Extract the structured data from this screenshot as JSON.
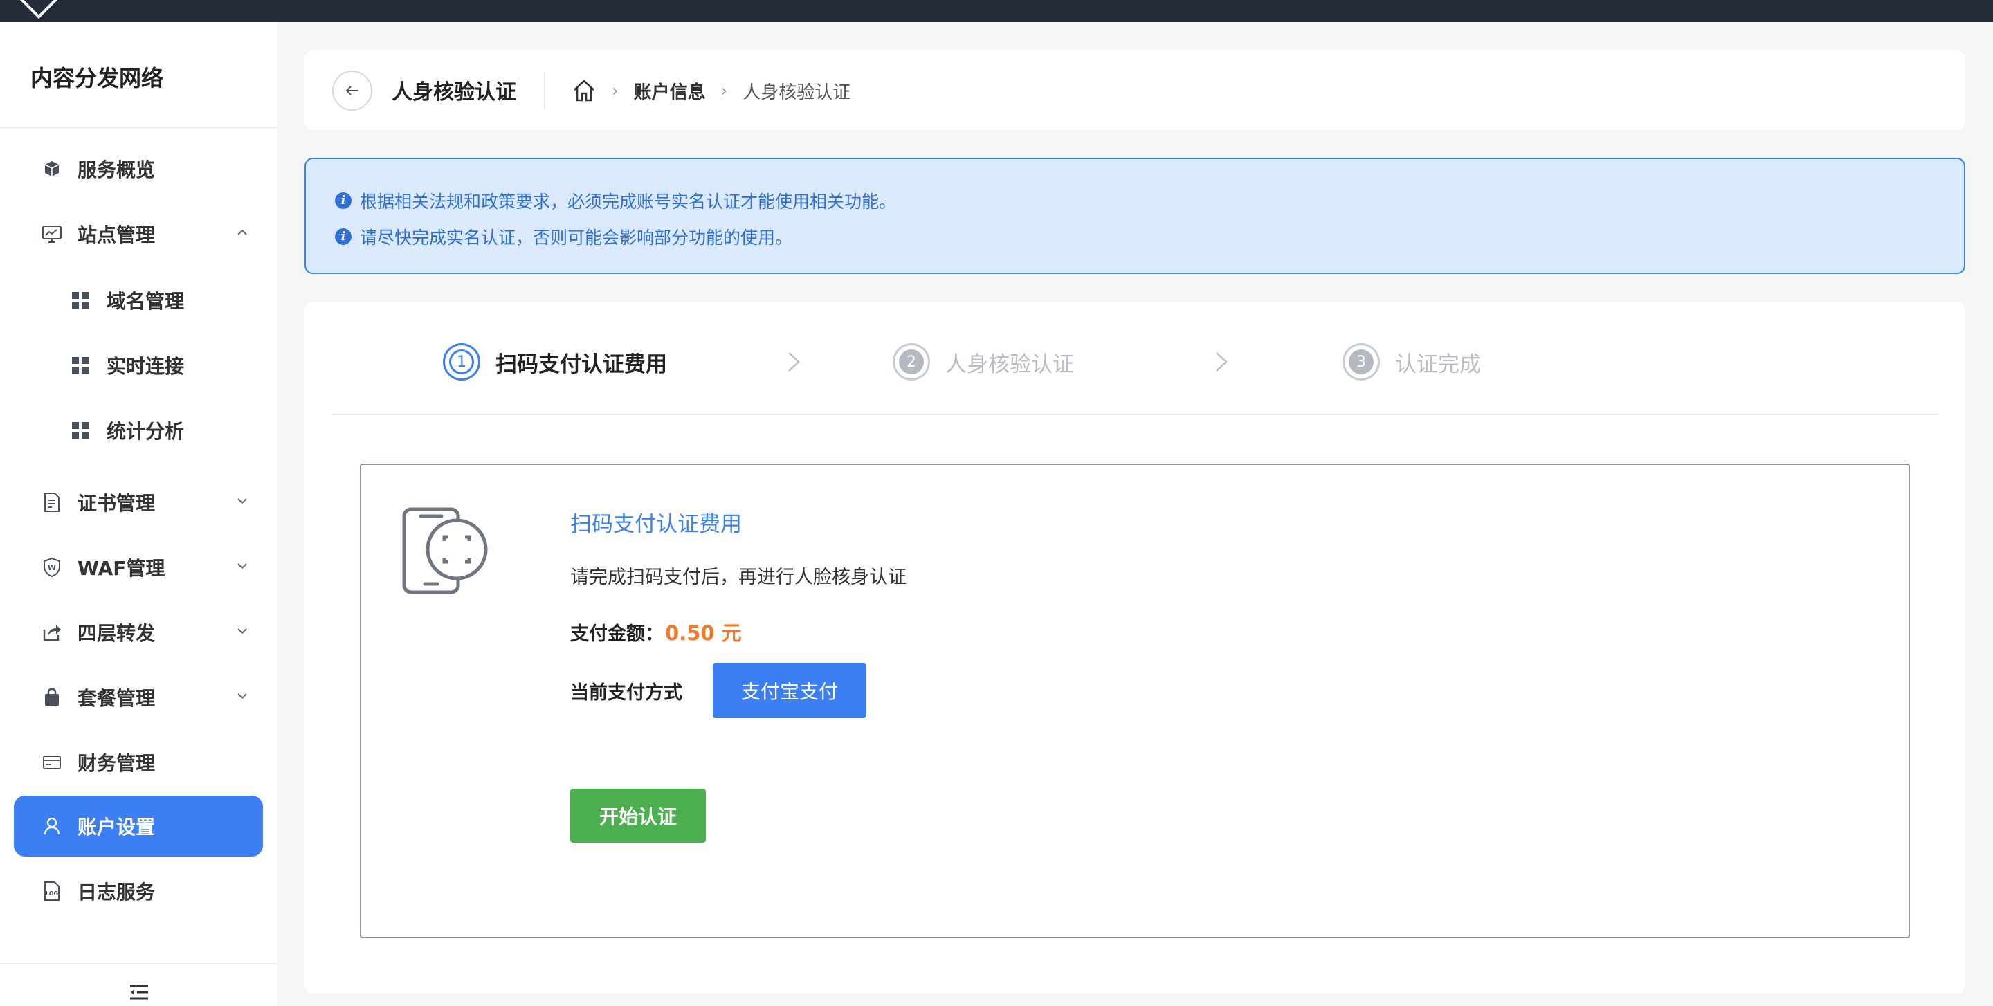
{
  "brand": "内容分发网络",
  "sidebar": {
    "items": [
      {
        "label": "服务概览",
        "icon": "cube-icon"
      },
      {
        "label": "站点管理",
        "icon": "monitor-chart-icon",
        "expanded": true
      },
      {
        "label": "域名管理",
        "icon": "grid-icon"
      },
      {
        "label": "实时连接",
        "icon": "grid-icon"
      },
      {
        "label": "统计分析",
        "icon": "grid-icon"
      },
      {
        "label": "证书管理",
        "icon": "certificate-icon"
      },
      {
        "label": "WAF管理",
        "icon": "shield-icon"
      },
      {
        "label": "四层转发",
        "icon": "share-icon"
      },
      {
        "label": "套餐管理",
        "icon": "bag-icon"
      },
      {
        "label": "财务管理",
        "icon": "card-icon"
      },
      {
        "label": "账户设置",
        "icon": "user-icon",
        "active": true
      },
      {
        "label": "日志服务",
        "icon": "log-icon"
      }
    ]
  },
  "header": {
    "title": "人身核验认证",
    "breadcrumb": [
      "账户信息",
      "人身核验认证"
    ]
  },
  "alert": {
    "lines": [
      "根据相关法规和政策要求，必须完成账号实名认证才能使用相关功能。",
      "请尽快完成实名认证，否则可能会影响部分功能的使用。"
    ]
  },
  "steps": [
    {
      "num": "1",
      "label": "扫码支付认证费用",
      "state": "active"
    },
    {
      "num": "2",
      "label": "人身核验认证",
      "state": "todo"
    },
    {
      "num": "3",
      "label": "认证完成",
      "state": "todo"
    }
  ],
  "payment": {
    "title": "扫码支付认证费用",
    "desc": "请完成扫码支付后，再进行人脸核身认证",
    "amount_label": "支付金额：",
    "amount_value": "0.50 元",
    "method_label": "当前支付方式",
    "method_button": "支付宝支付",
    "start_button": "开始认证"
  },
  "colors": {
    "accent": "#3b7ff2",
    "topbar": "#232a38",
    "amount": "#f07a2a",
    "start": "#4caf50"
  }
}
